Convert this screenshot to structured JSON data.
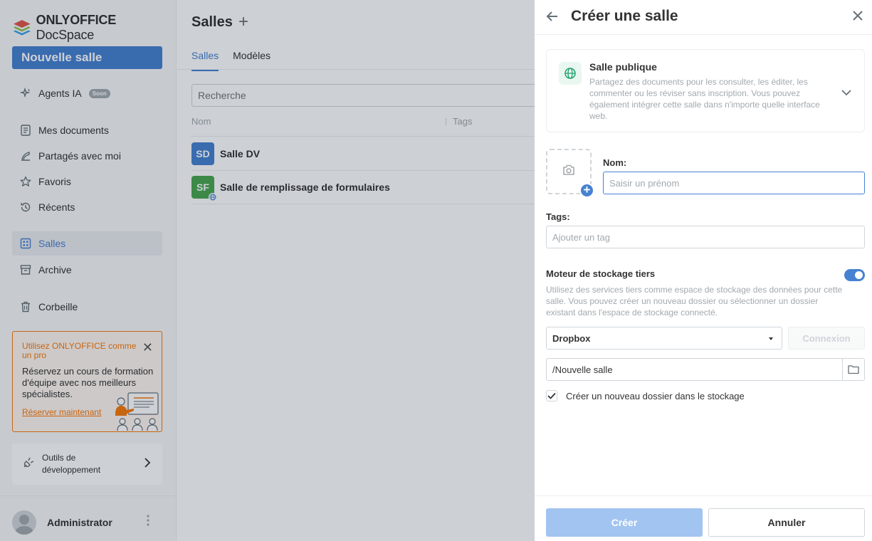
{
  "app": {
    "logo_brand": "ONLYOFFICE",
    "logo_product": "DocSpace"
  },
  "sidebar": {
    "new_room_label": "Nouvelle salle",
    "items": [
      {
        "label": "Agents IA",
        "badge": "Soon",
        "icon": "sparkle-icon"
      },
      {
        "label": "Mes documents",
        "icon": "document-icon"
      },
      {
        "label": "Partagés avec moi",
        "icon": "shared-icon"
      },
      {
        "label": "Favoris",
        "icon": "star-icon"
      },
      {
        "label": "Récents",
        "icon": "history-icon"
      },
      {
        "label": "Salles",
        "icon": "rooms-icon",
        "active": true
      },
      {
        "label": "Archive",
        "icon": "archive-icon"
      },
      {
        "label": "Corbeille",
        "icon": "trash-icon"
      }
    ],
    "promo": {
      "title": "Utilisez ONLYOFFICE comme un pro",
      "text": "Réservez un cours de formation d'équipe avec nos meilleurs spécialistes.",
      "link": "Réserver maintenant"
    },
    "devtools_label": "Outils de développement",
    "user_name": "Administrator"
  },
  "main": {
    "title": "Salles",
    "tabs": [
      {
        "label": "Salles",
        "active": true
      },
      {
        "label": "Modèles",
        "active": false
      }
    ],
    "search_placeholder": "Recherche",
    "columns": {
      "name": "Nom",
      "tags": "Tags"
    },
    "rows": [
      {
        "initials": "SD",
        "name": "Salle DV",
        "color": "#4781d1"
      },
      {
        "initials": "SF",
        "name": "Salle de remplissage de formulaires",
        "color": "#4ba750"
      }
    ]
  },
  "dialog": {
    "title": "Créer une salle",
    "room_type": {
      "title": "Salle publique",
      "description": "Partagez des documents pour les consulter, les éditer, les commenter ou les réviser sans inscription. Vous pouvez également intégrer cette salle dans n'importe quelle interface web."
    },
    "name_label": "Nom:",
    "name_placeholder": "Saisir un prénom",
    "tags_label": "Tags:",
    "tags_placeholder": "Ajouter un tag",
    "storage": {
      "title": "Moteur de stockage tiers",
      "enabled": true,
      "description": "Utilisez des services tiers comme espace de stockage des données pour cette salle. Vous pouvez créer un nouveau dossier ou sélectionner un dossier existant dans l'espace de stockage connecté.",
      "provider": "Dropbox",
      "connect_label": "Connexion",
      "path": "/Nouvelle salle",
      "create_folder_label": "Créer un nouveau dossier dans le stockage",
      "create_folder_checked": true
    },
    "create_label": "Créer",
    "cancel_label": "Annuler"
  },
  "colors": {
    "accent": "#4781d1",
    "promo": "#f97a0b",
    "public_room": "#22a06b"
  }
}
